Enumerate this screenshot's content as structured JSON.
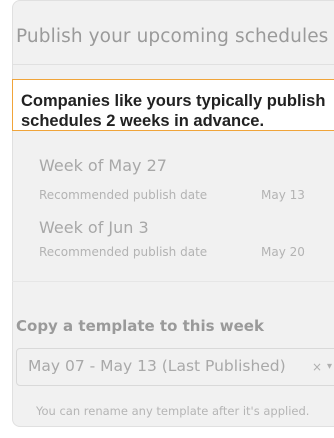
{
  "header": {
    "title": "Publish your upcoming schedules"
  },
  "callout": {
    "line1": "Companies like yours typically publish",
    "line2": "schedules 2 weeks in advance.",
    "border_color": "#f0a43a"
  },
  "weeks": [
    {
      "label": "Week of May 27",
      "recommended_label": "Recommended publish date",
      "recommended_date": "May 13"
    },
    {
      "label": "Week of Jun 3",
      "recommended_label": "Recommended publish date",
      "recommended_date": "May 20"
    }
  ],
  "template_section": {
    "title": "Copy a template to this week",
    "selected_value": "May 07 - May 13 (Last Published)",
    "clear_icon": "×",
    "dropdown_icon": "▾",
    "hint": "You can rename any template after it's applied."
  }
}
